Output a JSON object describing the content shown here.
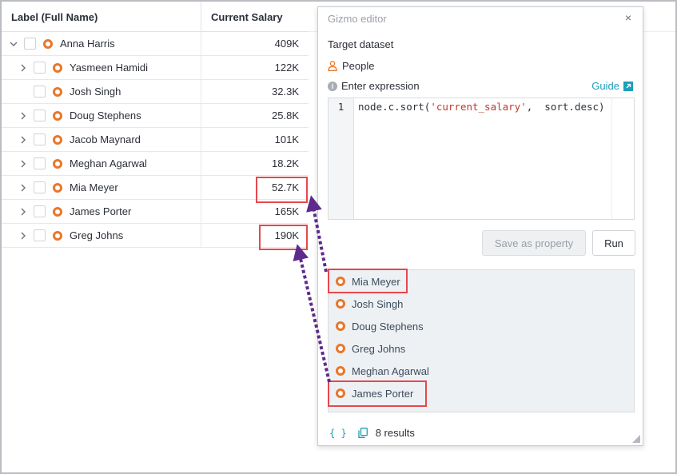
{
  "table": {
    "columns": [
      "Label (Full Name)",
      "Current Salary"
    ],
    "rows": [
      {
        "name": "Anna Harris",
        "salary": "409K",
        "level": 0,
        "expanded": true
      },
      {
        "name": "Yasmeen Hamidi",
        "salary": "122K",
        "level": 1,
        "expandable": true
      },
      {
        "name": "Josh Singh",
        "salary": "32.3K",
        "level": 1,
        "expandable": false
      },
      {
        "name": "Doug Stephens",
        "salary": "25.8K",
        "level": 1,
        "expandable": true
      },
      {
        "name": "Jacob Maynard",
        "salary": "101K",
        "level": 1,
        "expandable": true
      },
      {
        "name": "Meghan Agarwal",
        "salary": "18.2K",
        "level": 1,
        "expandable": true
      },
      {
        "name": "Mia Meyer",
        "salary": "52.7K",
        "level": 1,
        "expandable": true
      },
      {
        "name": "James Porter",
        "salary": "165K",
        "level": 1,
        "expandable": true
      },
      {
        "name": "Greg Johns",
        "salary": "190K",
        "level": 1,
        "expandable": true
      }
    ]
  },
  "gizmo": {
    "title": "Gizmo editor",
    "close": "×",
    "target_label": "Target dataset",
    "dataset": "People",
    "expression_label": "Enter expression",
    "guide_label": "Guide",
    "code": {
      "line_number": "1",
      "prefix": "node.c.sort(",
      "string_arg": "'current_salary'",
      "suffix": ",  sort.desc)"
    },
    "save_label": "Save as property",
    "run_label": "Run",
    "results": [
      "Mia Meyer",
      "Josh Singh",
      "Doug Stephens",
      "Greg Johns",
      "Meghan Agarwal",
      "James Porter"
    ],
    "results_count": "8 results",
    "braces": "{ }"
  },
  "colors": {
    "node_orange": "#e9772a",
    "highlight_red": "#e5484d",
    "arrow_purple": "#5e2a8c",
    "link_teal": "#1c9fb8"
  }
}
